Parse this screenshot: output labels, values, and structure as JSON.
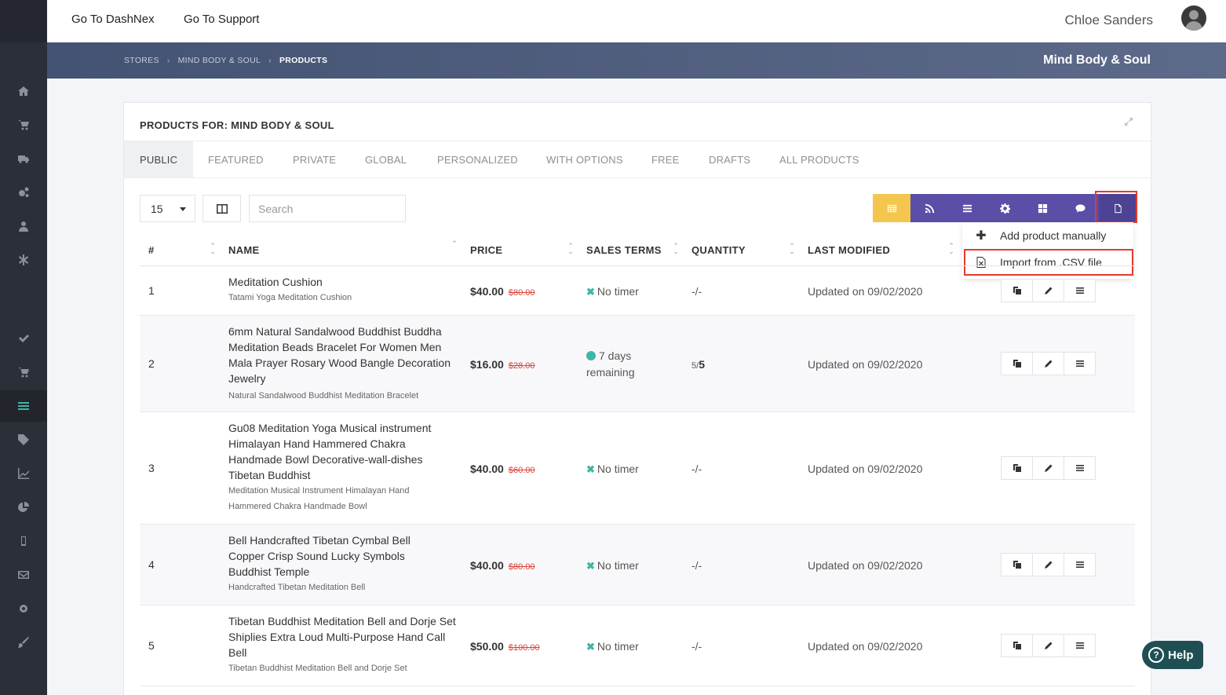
{
  "topbar": {
    "links": [
      "Go To DashNex",
      "Go To Support"
    ],
    "user_name": "Chloe Sanders"
  },
  "sidebar": {
    "icons": [
      "home-icon",
      "cart-icon",
      "truck-icon",
      "cogs-icon",
      "user-icon",
      "asterisk-icon",
      "check-icon",
      "cart-icon",
      "list-icon",
      "tags-icon",
      "line-chart-icon",
      "pie-chart-icon",
      "mobile-icon",
      "envelope-icon",
      "gear-icon",
      "brush-icon"
    ],
    "active_item": "list-icon"
  },
  "breadcrumb": [
    "STORES",
    "MIND BODY & SOUL",
    "PRODUCTS"
  ],
  "store_name": "Mind Body & Soul",
  "card_title": "PRODUCTS FOR: MIND BODY & SOUL",
  "tabs": [
    "PUBLIC",
    "FEATURED",
    "PRIVATE",
    "GLOBAL",
    "PERSONALIZED",
    "WITH OPTIONS",
    "FREE",
    "DRAFTS",
    "ALL PRODUCTS"
  ],
  "active_tab": "PUBLIC",
  "per_page": "15",
  "search_placeholder": "Search",
  "toolbar_icons": [
    "table-icon",
    "rss-icon",
    "list-icon",
    "gear-icon",
    "grid-icon",
    "comment-icon",
    "file-icon"
  ],
  "dropdown": {
    "items": [
      "Add product manually",
      "Import from .CSV file"
    ]
  },
  "columns": [
    "#",
    "NAME",
    "PRICE",
    "SALES TERMS",
    "QUANTITY",
    "LAST MODIFIED"
  ],
  "rows": [
    {
      "num": "1",
      "name": "Meditation Cushion",
      "sub": "Tatami Yoga Meditation Cushion",
      "price": "$40.00",
      "old_price": "$80.00",
      "terms": "No timer",
      "qty": "-/-",
      "modified": "Updated on 09/02/2020"
    },
    {
      "num": "2",
      "name": "6mm Natural Sandalwood Buddhist Buddha Meditation Beads Bracelet For Women Men Mala Prayer Rosary Wood Bangle Decoration Jewelry",
      "sub": "Natural Sandalwood Buddhist Meditation Bracelet",
      "price": "$16.00",
      "old_price": "$28.00",
      "terms": "7 days remaining",
      "qty_a": "5/",
      "qty_b": "5",
      "modified": "Updated on 09/02/2020"
    },
    {
      "num": "3",
      "name": "Gu08 Meditation Yoga Musical instrument Himalayan Hand Hammered Chakra Handmade Bowl Decorative-wall-dishes Tibetan Buddhist",
      "sub": "Meditation Musical Instrument Himalayan Hand Hammered Chakra Handmade Bowl",
      "price": "$40.00",
      "old_price": "$60.00",
      "terms": "No timer",
      "qty": "-/-",
      "modified": "Updated on 09/02/2020"
    },
    {
      "num": "4",
      "name": "Bell Handcrafted Tibetan Cymbal Bell Copper Crisp Sound Lucky Symbols Buddhist Temple",
      "sub": "Handcrafted Tibetan Meditation Bell",
      "price": "$40.00",
      "old_price": "$80.00",
      "terms": "No timer",
      "qty": "-/-",
      "modified": "Updated on 09/02/2020"
    },
    {
      "num": "5",
      "name": "Tibetan Buddhist Meditation Bell and Dorje Set Shiplies Extra Loud Multi-Purpose Hand Call Bell",
      "sub": "Tibetan Buddhist Meditation Bell and Dorje Set",
      "price": "$50.00",
      "old_price": "$100.00",
      "terms": "No timer",
      "qty": "-/-",
      "modified": "Updated on 09/02/2020"
    }
  ],
  "help_label": "Help",
  "colors": {
    "accent_purple": "#5b4ea6",
    "accent_yellow": "#f5c64d",
    "header_band": "#445273",
    "highlight_red": "#e43a2d",
    "teal": "#3fb6a6"
  }
}
